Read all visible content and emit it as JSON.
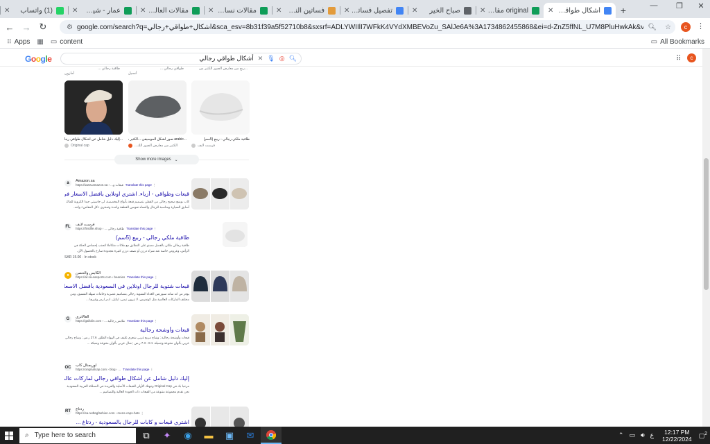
{
  "browser": {
    "tabs": [
      {
        "title": "(1) واتساب",
        "favicon_color": "#25d366",
        "active": false
      },
      {
        "title": "عمار - شيت محتوى",
        "favicon_color": "#0f9d58",
        "active": false
      },
      {
        "title": "مقالات العالم الراب",
        "favicon_color": "#0f9d58",
        "active": false
      },
      {
        "title": "مقالات نساء - نيا",
        "favicon_color": "#0f9d58",
        "active": false
      },
      {
        "title": "فساتين النساء: الأ",
        "favicon_color": "#e39b3b",
        "active": false
      },
      {
        "title": "تفصيل فساتين ب",
        "favicon_color": "#4285f4",
        "active": false
      },
      {
        "title": "صباح الخير",
        "favicon_color": "#5f6368",
        "active": false
      },
      {
        "title": "original مقالات",
        "favicon_color": "#0f9d58",
        "active": false
      },
      {
        "title": "أشكال طواقي رج",
        "favicon_color": "#4285f4",
        "active": true
      }
    ],
    "new_tab_label": "+",
    "url": "google.com/search?q=أشكال+طواقي+رجالي&sca_esv=8b31f39a5f52710b8&sxsrf=ADLYWIIlI7WFkK4VYdXMBEVoZu_SAlJe6A%3A1734862455868&ei=d-ZnZ5ffNL_U7M8PluHwkAk&ved=0ahUKEwjX9qmjkruKAxU_KvsDHZ...",
    "profile_initial": "c",
    "bookmarks": [
      {
        "label": "Apps"
      },
      {
        "label": "content"
      }
    ],
    "all_bookmarks_label": "All Bookmarks"
  },
  "google": {
    "logo": "Google",
    "query": "أشكال طواقي رجالي",
    "profile_initial": "c",
    "prev_row_captions": [
      "طاقية رجالي ...",
      "طواقي رجالي ...",
      "...ربح من معارض الصور الكثير من"
    ],
    "prev_row_sources": [
      "أمازون",
      "أنسيل",
      ""
    ],
    "images": [
      {
        "caption": "...إليك دليل شامل عن أشكال طواقي رجالي لماركات",
        "source": "Original cap",
        "dot_color": "#cccccc"
      },
      {
        "caption": "...arabic صور لشكل الموسيقى ...الكثير من",
        "source": "...الكثير من معارض الصور الك",
        "dot_color": "#e8551f"
      },
      {
        "caption": "طاقية ملكي رجالي - ربيع (5سم)",
        "source": "فرست لايف",
        "dot_color": "#cccccc"
      }
    ],
    "show_more_label": "Show more images",
    "results": [
      {
        "site_name": "Amazon.sa",
        "url": "https://www.amazon.sa › ...قبعات و",
        "translate_label": "Translate this page",
        "title": "قبعات وطواقي - أزياء. اشتري اونلاين بأفضل الاسعار في ...",
        "snippet": "كاب بوسع صحيح رجالي من القطن بتصميم قبعة بأنواع المخصصة، لي جاسيتي جيدا الكروية للماك أسايق السيارة ومناسبة للرجال والنساء نعومين القطعة واحدة وتمنتري «كل المقاس» واحد.",
        "meta": "",
        "favicon": "a"
      },
      {
        "site_name": "فرست لايف",
        "url": "https://firstlife.shop › ... طاقية رجالي",
        "translate_label": "Translate this page",
        "title": "طاقية ملكي رجالي - ربيع (5سم)",
        "snippet": "طاقية رجالي ملكي بالفصل مصنو على التطابق مع ملاتات متكاملا لتجنب إحساس الحكة في الرأس، وعروض خاصة عند شراء درزن أو نصف درزن كثيرة مجدودة سارع بالحصول الآن.",
        "meta": "SAR 15.00 · In stock",
        "favicon": "FL"
      },
      {
        "site_name": "الكابس والحصن",
        "url": "https://ar.sa.easports.com › beanies",
        "translate_label": "Translate this page",
        "title": "قبعات شتوية للرجال اونلاين في السعودية بأفضل الاسعار - SSS",
        "snippet": "يوفر من اند ساند سبورتس الغذاء الشتوية رجالي بتصاميم عصرية وخامات سهلة التنسيق، ومن مختلف الماركات العالمية مثل كونفرس، لا تيرون تيمي، ايكبل، اندر ارمر وغيرها ...",
        "meta": "",
        "favicon": "●"
      },
      {
        "site_name": "الغالاتري",
        "url": "https://gallolin.com › ... ملابس رجالية",
        "translate_label": "Translate this page",
        "title": "قبعات وأوشحة رجالية",
        "snippet": "قبعات وأوشحة رجالية ; وشاح مربع عربي شعري غليف في الهواء الطلق. 27.6 ر.س ; وشاح رجالي عربي بألوان متنوعة وجميلة. 8.1 - 7.3 ر.س ; شال عربي بألوان متنوعة وشبكة ...",
        "meta": "",
        "favicon": "G"
      },
      {
        "site_name": "اوريجنال كاب",
        "url": "https://originalcap.com › blog › ...",
        "translate_label": "Translate this page",
        "title": "إليك دليل شامل عن أشكال طواقي رجالي لماركات عالمية",
        "snippet": "مرحبا بك في Original Cap وجهتك الأولى للقبعات الأصلية والفريدة في المملكة العربية السعودية نحن نقدم مجموعة متنوعة من القبعات ذات الجودة العالية والتصاميم ...",
        "meta": "",
        "favicon": "OC"
      },
      {
        "site_name": "ردتاج",
        "url": "https://sa.redtagfashion.com › mens-caps-hats",
        "translate_label": "",
        "title": "اشتري قبعات و كابات للرجال بالسعودية - ردتاغ ...",
        "snippet": "",
        "meta": "",
        "favicon": "RT"
      }
    ]
  },
  "taskbar": {
    "search_placeholder": "Type here to search",
    "time": "12:17 PM",
    "date": "12/22/2024",
    "lang": "ع",
    "notifications": "2"
  }
}
